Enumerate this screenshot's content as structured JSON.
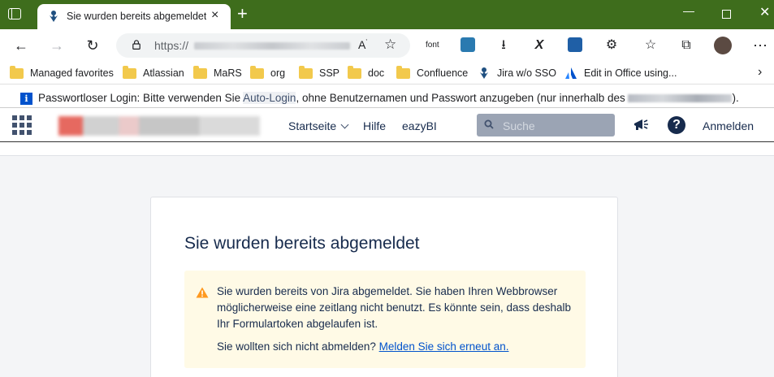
{
  "browser": {
    "tab_title": "Sie wurden bereits abgemeldet -",
    "tab_close": "×",
    "new_tab": "+",
    "url_prefix": "https://",
    "read_aloud": "A̅",
    "ext_font_label": "font",
    "window_controls": {
      "minimize": "—",
      "maximize": "",
      "close": "✕"
    },
    "accent_color": "#3e6d1c"
  },
  "bookmarks": [
    {
      "label": "Managed favorites",
      "icon": "folder-icon"
    },
    {
      "label": "Atlassian",
      "icon": "folder-icon"
    },
    {
      "label": "MaRS",
      "icon": "folder-icon"
    },
    {
      "label": "org",
      "icon": "folder-icon"
    },
    {
      "label": "SSP",
      "icon": "folder-icon"
    },
    {
      "label": "doc",
      "icon": "folder-icon"
    },
    {
      "label": "Confluence",
      "icon": "folder-icon"
    },
    {
      "label": "Jira w/o SSO",
      "icon": "jira-icon"
    },
    {
      "label": "Edit in Office using...",
      "icon": "atlassian-icon"
    }
  ],
  "infobar": {
    "before": "Passwortloser Login: Bitte verwenden Sie ",
    "highlight": "Auto-Login",
    "after": ", ohne Benutzernamen und Passwort anzugeben (nur innerhalb des ",
    "end": ")."
  },
  "header": {
    "nav": {
      "home": "Startseite",
      "help": "Hilfe",
      "eazybi": "eazyBI"
    },
    "search_placeholder": "Suche",
    "help_glyph": "?",
    "login": "Anmelden"
  },
  "main": {
    "title": "Sie wurden bereits abgemeldet",
    "warning": "Sie wurden bereits von Jira abgemeldet. Sie haben Ihren Webbrowser möglicherweise eine zeitlang nicht benutzt. Es könnte sein, dass deshalb Ihr Formulartoken abgelaufen ist.",
    "prompt": "Sie wollten sich nicht abmelden? ",
    "relogin_link": "Melden Sie sich erneut an."
  }
}
